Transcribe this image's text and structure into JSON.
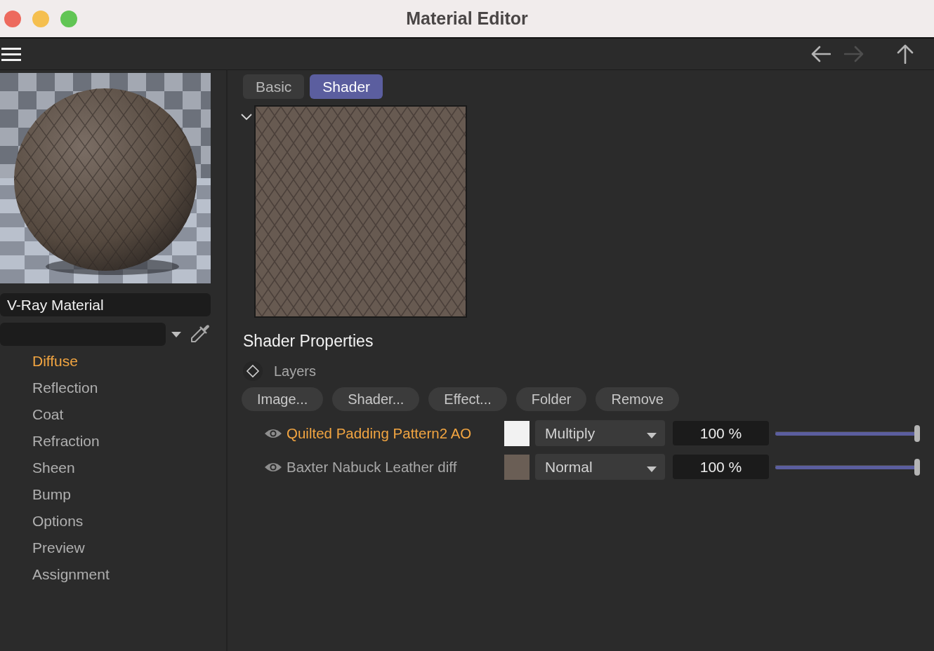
{
  "window": {
    "title": "Material Editor"
  },
  "toolbar": {
    "nav_buttons": [
      {
        "kind": "back",
        "disabled": false
      },
      {
        "kind": "forward",
        "disabled": true
      },
      {
        "kind": "up",
        "disabled": false
      }
    ]
  },
  "material": {
    "name": "V-Ray Material"
  },
  "sidebar": {
    "items": [
      {
        "label": "Diffuse",
        "selected": true
      },
      {
        "label": "Reflection",
        "selected": false
      },
      {
        "label": "Coat",
        "selected": false
      },
      {
        "label": "Refraction",
        "selected": false
      },
      {
        "label": "Sheen",
        "selected": false
      },
      {
        "label": "Bump",
        "selected": false
      },
      {
        "label": "Options",
        "selected": false
      },
      {
        "label": "Preview",
        "selected": false
      },
      {
        "label": "Assignment",
        "selected": false
      }
    ]
  },
  "tabs": [
    {
      "label": "Basic",
      "selected": false
    },
    {
      "label": "Shader",
      "selected": true
    }
  ],
  "preview": {
    "expanded": true
  },
  "shader_properties": {
    "title": "Shader Properties",
    "layers_label": "Layers",
    "buttons": [
      "Image...",
      "Shader...",
      "Effect...",
      "Folder",
      "Remove"
    ],
    "layers": [
      {
        "name": "Quilted Padding Pattern2 AO",
        "selected": true,
        "visible": true,
        "color": "#f2f2f2",
        "blend_mode": "Multiply",
        "opacity": "100 %",
        "level": 1.0
      },
      {
        "name": "Baxter Nabuck Leather diff",
        "selected": false,
        "visible": true,
        "color": "#6a5e55",
        "blend_mode": "Normal",
        "opacity": "100 %",
        "level": 1.0
      }
    ]
  }
}
